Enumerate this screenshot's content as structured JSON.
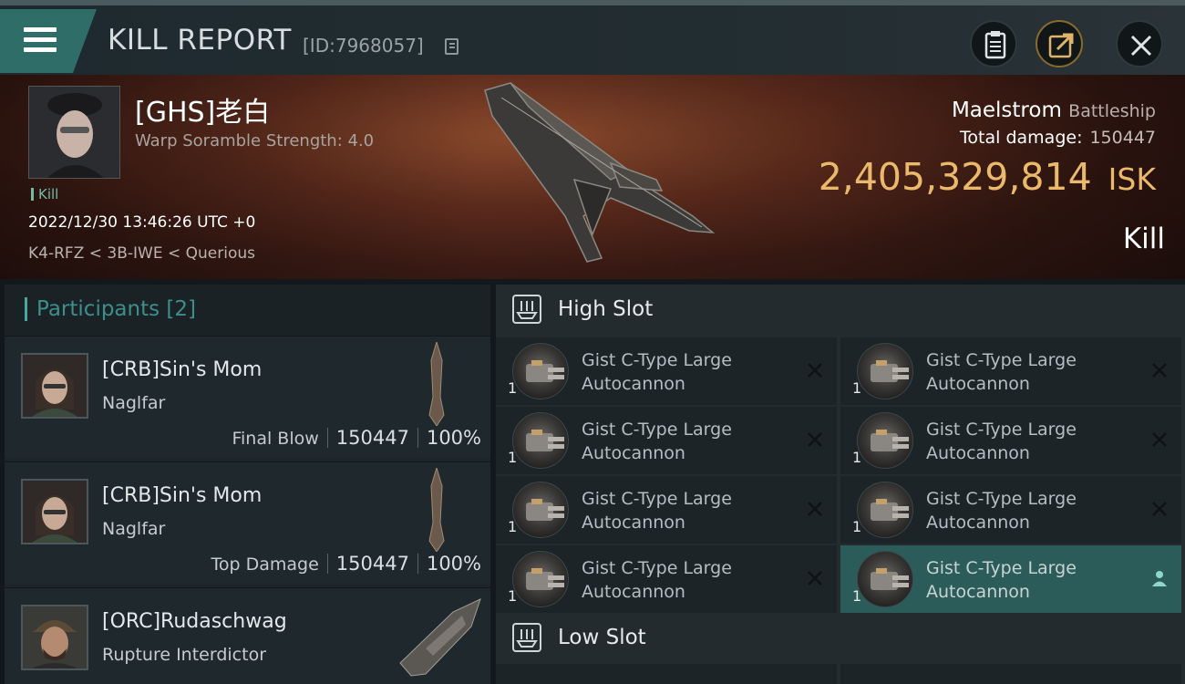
{
  "header": {
    "title": "KILL REPORT",
    "report_id": "[ID:7968057]",
    "icons": [
      "menu-icon",
      "clipboard-icon",
      "share-icon",
      "close-icon"
    ]
  },
  "victim": {
    "name": "[GHS]老白",
    "subtitle": "Warp Soramble Strength: 4.0",
    "tag": "Kill",
    "datetime": "2022/12/30 13:46:26 UTC +0",
    "location": "K4-RFZ < 3B-IWE < Querious",
    "ship_name": "Maelstrom",
    "ship_class": "Battleship",
    "total_damage_label": "Total damage:",
    "total_damage": "150447",
    "isk_value": "2,405,329,814",
    "isk_unit": "ISK",
    "kill_type": "Kill"
  },
  "participants": {
    "title": "Participants",
    "count": "[2]",
    "items": [
      {
        "name": "[CRB]Sin's Mom",
        "ship": "Naglfar",
        "role": "Final Blow",
        "damage": "150447",
        "percent": "100%"
      },
      {
        "name": "[CRB]Sin's Mom",
        "ship": "Naglfar",
        "role": "Top Damage",
        "damage": "150447",
        "percent": "100%"
      },
      {
        "name": "[ORC]Rudaschwag",
        "ship": "Rupture Interdictor"
      }
    ]
  },
  "slots": {
    "high_title": "High Slot",
    "low_title": "Low Slot",
    "modules": [
      {
        "line1": "Gist C-Type Large",
        "line2": "Autocannon",
        "qty": "1"
      },
      {
        "line1": "Gist C-Type Large",
        "line2": "Autocannon",
        "qty": "1"
      },
      {
        "line1": "Gist C-Type Large",
        "line2": "Autocannon",
        "qty": "1"
      },
      {
        "line1": "Gist C-Type Large",
        "line2": "Autocannon",
        "qty": "1"
      },
      {
        "line1": "Gist C-Type Large",
        "line2": "Autocannon",
        "qty": "1"
      },
      {
        "line1": "Gist C-Type Large",
        "line2": "Autocannon",
        "qty": "1"
      },
      {
        "line1": "Gist C-Type Large",
        "line2": "Autocannon",
        "qty": "1"
      },
      {
        "line1": "Gist C-Type Large",
        "line2": "Autocannon",
        "qty": "1",
        "highlighted": true
      }
    ]
  },
  "colors": {
    "accent_teal": "#4aa7a0",
    "isk_gold": "#eab96b",
    "highlight_row": "#2b5c5a"
  }
}
